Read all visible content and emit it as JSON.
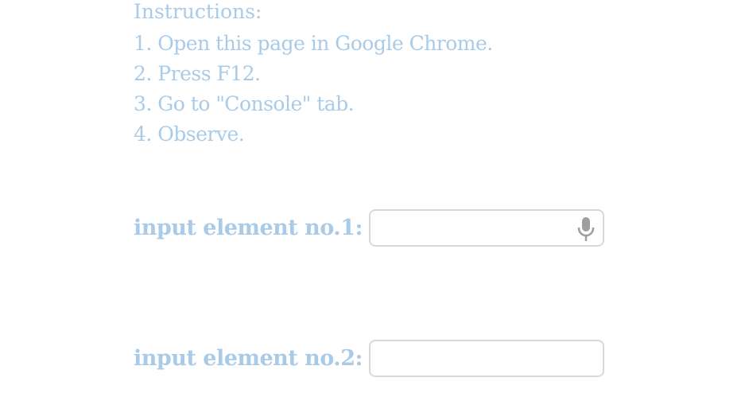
{
  "instructions": {
    "heading": "Instructions:",
    "steps": [
      "1. Open this page in Google Chrome.",
      "2. Press F12.",
      "3. Go to \"Console\" tab.",
      "4. Observe."
    ]
  },
  "inputs": [
    {
      "label": "input element no.1:",
      "value": "",
      "has_mic": true,
      "mic_icon": "microphone-icon"
    },
    {
      "label": "input element no.2:",
      "value": "",
      "has_mic": false
    }
  ],
  "colors": {
    "text": "#a9cbe8",
    "field_border": "#d9d9d9",
    "mic_icon": "#9e9e9e"
  }
}
